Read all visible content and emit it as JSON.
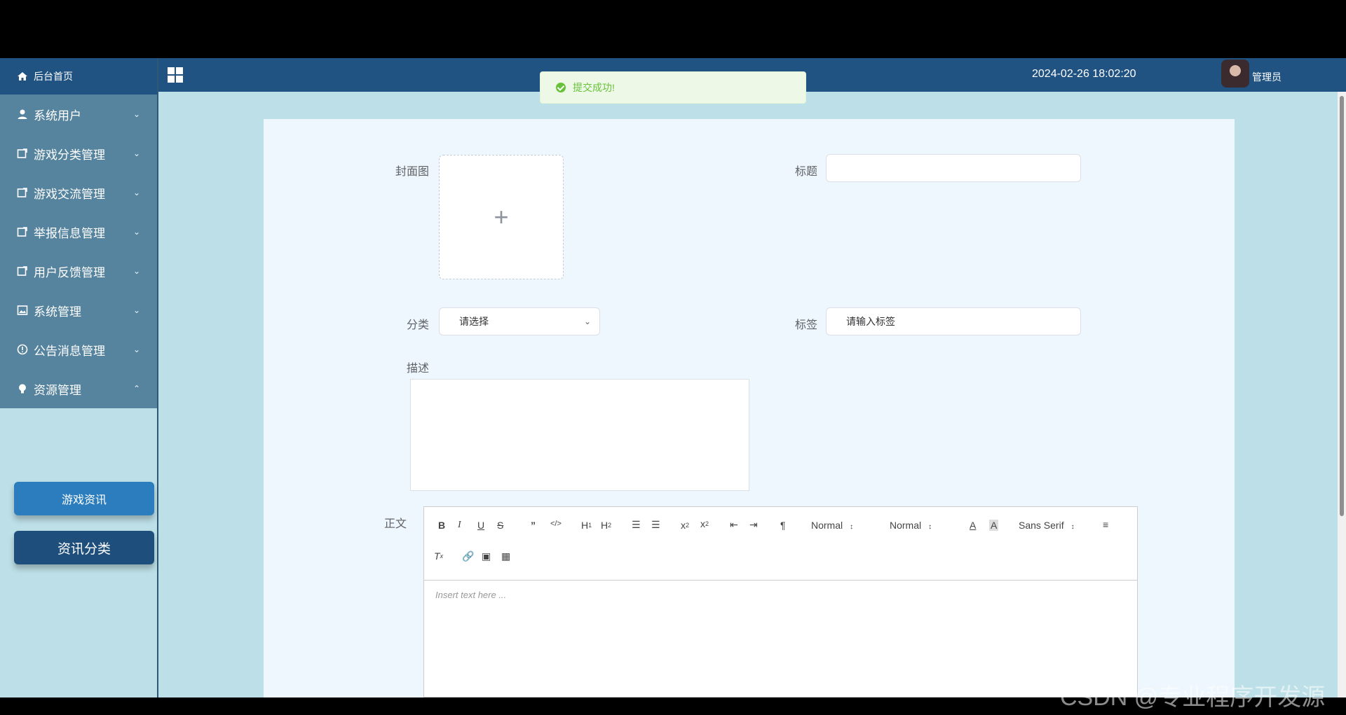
{
  "sidebar": {
    "home": "后台首页",
    "items": [
      {
        "label": "系统用户",
        "icon": "user-icon"
      },
      {
        "label": "游戏分类管理",
        "icon": "edit-icon"
      },
      {
        "label": "游戏交流管理",
        "icon": "edit-icon"
      },
      {
        "label": "举报信息管理",
        "icon": "edit-icon"
      },
      {
        "label": "用户反馈管理",
        "icon": "edit-icon"
      },
      {
        "label": "系统管理",
        "icon": "picture-icon"
      },
      {
        "label": "公告消息管理",
        "icon": "info-icon"
      },
      {
        "label": "资源管理",
        "icon": "bulb-icon"
      }
    ],
    "sub_items": [
      "游戏资讯",
      "资讯分类"
    ]
  },
  "header": {
    "title": "",
    "datetime": "2024-02-26 18:02:20",
    "user": "管理员"
  },
  "toast": {
    "message": "提交成功!"
  },
  "form": {
    "cover_label": "封面图",
    "title_label": "标题",
    "title_value": "",
    "category_label": "分类",
    "category_placeholder": "请选择",
    "tags_label": "标签",
    "tags_placeholder": "请输入标签",
    "desc_label": "描述",
    "body_label": "正文",
    "editor": {
      "placeholder": "Insert text here ...",
      "header_select": "Normal",
      "size_select": "Normal",
      "font_select": "Sans Serif"
    }
  },
  "watermark": "CSDN @专业程序开发源",
  "colors": {
    "header_bg": "#205382",
    "sidebar_menu_bg": "#56849f",
    "content_bg": "#bddfe7",
    "panel_bg": "#eef7fd",
    "active_sub": "#2b7dbe",
    "dark_sub": "#1e4e7c",
    "success": "#67c23a"
  }
}
